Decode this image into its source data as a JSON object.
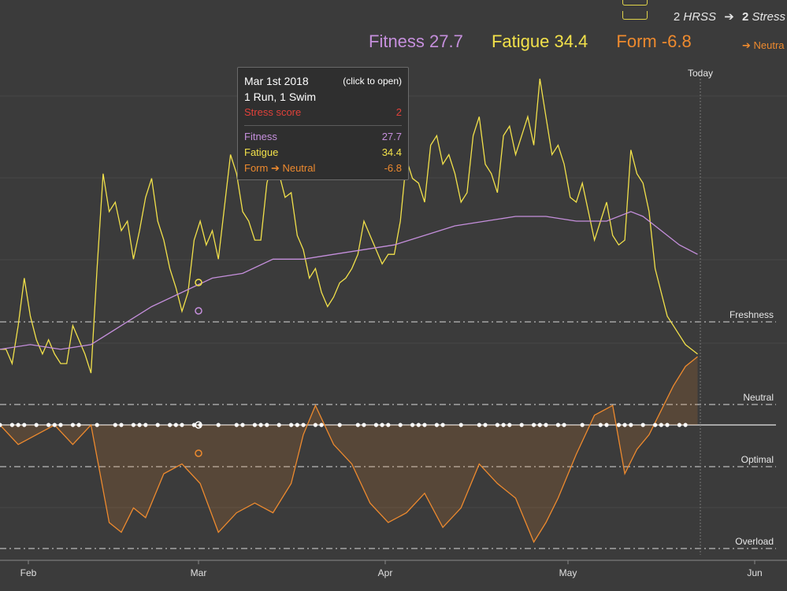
{
  "header": {
    "hrss_value": "2",
    "hrss_label": "HRSS",
    "arrow": "➔",
    "stress_value": "2",
    "stress_label": "Stress"
  },
  "legend": {
    "fitness": "Fitness 27.7",
    "fatigue": "Fatigue 34.4",
    "form": "Form -6.8",
    "form_status": "➔ Neutra"
  },
  "tooltip": {
    "date": "Mar 1st 2018",
    "open_link": "(click to open)",
    "activities": "1 Run, 1 Swim",
    "stress_label": "Stress score",
    "stress_value": "2",
    "fitness_label": "Fitness",
    "fitness_value": "27.7",
    "fatigue_label": "Fatigue",
    "fatigue_value": "34.4",
    "form_label": "Form ➔ Neutral",
    "form_value": "-6.8"
  },
  "colors": {
    "fitness": "#c58fdc",
    "fatigue": "#f2e14a",
    "form": "#ee8a2e",
    "stress": "#e0413a",
    "background": "#3b3b3b"
  },
  "chart_data": {
    "type": "line",
    "x_ticks": [
      "Feb",
      "Mar",
      "Apr",
      "May",
      "Jun"
    ],
    "today_label": "Today",
    "zone_labels": [
      "Freshness",
      "Neutral",
      "Optimal",
      "Overload"
    ],
    "series": [
      {
        "name": "Fatigue",
        "points": [
          [
            0,
            43
          ],
          [
            1,
            43
          ],
          [
            2,
            40
          ],
          [
            3,
            48
          ],
          [
            4,
            58
          ],
          [
            5,
            50
          ],
          [
            6,
            45
          ],
          [
            7,
            42
          ],
          [
            8,
            45
          ],
          [
            9,
            42
          ],
          [
            10,
            40
          ],
          [
            11,
            40
          ],
          [
            12,
            48
          ],
          [
            13,
            45
          ],
          [
            14,
            42
          ],
          [
            15,
            38
          ],
          [
            16,
            60
          ],
          [
            17,
            80
          ],
          [
            18,
            72
          ],
          [
            19,
            74
          ],
          [
            20,
            68
          ],
          [
            21,
            70
          ],
          [
            22,
            62
          ],
          [
            23,
            68
          ],
          [
            24,
            75
          ],
          [
            25,
            79
          ],
          [
            26,
            70
          ],
          [
            27,
            66
          ],
          [
            28,
            60
          ],
          [
            29,
            56
          ],
          [
            30,
            51
          ],
          [
            31,
            55
          ],
          [
            32,
            66
          ],
          [
            33,
            70
          ],
          [
            34,
            65
          ],
          [
            35,
            68
          ],
          [
            36,
            62
          ],
          [
            37,
            73
          ],
          [
            38,
            84
          ],
          [
            39,
            80
          ],
          [
            40,
            72
          ],
          [
            41,
            70
          ],
          [
            42,
            66
          ],
          [
            43,
            66
          ],
          [
            44,
            78
          ],
          [
            45,
            83
          ],
          [
            46,
            80
          ],
          [
            47,
            75
          ],
          [
            48,
            76
          ],
          [
            49,
            67
          ],
          [
            50,
            64
          ],
          [
            51,
            58
          ],
          [
            52,
            60
          ],
          [
            53,
            55
          ],
          [
            54,
            52
          ],
          [
            55,
            54
          ],
          [
            56,
            57
          ],
          [
            57,
            58
          ],
          [
            58,
            60
          ],
          [
            59,
            63
          ],
          [
            60,
            70
          ],
          [
            61,
            67
          ],
          [
            62,
            64
          ],
          [
            63,
            61
          ],
          [
            64,
            63
          ],
          [
            65,
            63
          ],
          [
            66,
            70
          ],
          [
            67,
            83
          ],
          [
            68,
            79
          ],
          [
            69,
            78
          ],
          [
            70,
            74
          ],
          [
            71,
            86
          ],
          [
            72,
            88
          ],
          [
            73,
            82
          ],
          [
            74,
            84
          ],
          [
            75,
            80
          ],
          [
            76,
            74
          ],
          [
            77,
            76
          ],
          [
            78,
            88
          ],
          [
            79,
            92
          ],
          [
            80,
            82
          ],
          [
            81,
            80
          ],
          [
            82,
            76
          ],
          [
            83,
            88
          ],
          [
            84,
            90
          ],
          [
            85,
            84
          ],
          [
            86,
            88
          ],
          [
            87,
            92
          ],
          [
            88,
            86
          ],
          [
            89,
            100
          ],
          [
            90,
            92
          ],
          [
            91,
            84
          ],
          [
            92,
            86
          ],
          [
            93,
            82
          ],
          [
            94,
            75
          ],
          [
            95,
            74
          ],
          [
            96,
            78
          ],
          [
            97,
            72
          ],
          [
            98,
            66
          ],
          [
            99,
            70
          ],
          [
            100,
            74
          ],
          [
            101,
            67
          ],
          [
            102,
            65
          ],
          [
            103,
            66
          ],
          [
            104,
            85
          ],
          [
            105,
            80
          ],
          [
            106,
            78
          ],
          [
            107,
            72
          ],
          [
            108,
            60
          ],
          [
            109,
            55
          ],
          [
            110,
            50
          ],
          [
            111,
            48
          ],
          [
            112,
            46
          ],
          [
            113,
            44
          ],
          [
            114,
            43
          ],
          [
            115,
            42
          ]
        ]
      },
      {
        "name": "Fitness",
        "points": [
          [
            0,
            43
          ],
          [
            5,
            44
          ],
          [
            10,
            43
          ],
          [
            15,
            44
          ],
          [
            20,
            48
          ],
          [
            25,
            52
          ],
          [
            30,
            55
          ],
          [
            35,
            58
          ],
          [
            40,
            59
          ],
          [
            45,
            62
          ],
          [
            50,
            62
          ],
          [
            55,
            63
          ],
          [
            60,
            64
          ],
          [
            65,
            65
          ],
          [
            70,
            67
          ],
          [
            75,
            69
          ],
          [
            80,
            70
          ],
          [
            85,
            71
          ],
          [
            90,
            71
          ],
          [
            95,
            70
          ],
          [
            100,
            70
          ],
          [
            104,
            72
          ],
          [
            106,
            71
          ],
          [
            108,
            69
          ],
          [
            110,
            67
          ],
          [
            112,
            65
          ],
          [
            115,
            63
          ]
        ]
      },
      {
        "name": "Form",
        "points": [
          [
            0,
            0
          ],
          [
            3,
            -4
          ],
          [
            6,
            -2
          ],
          [
            9,
            0
          ],
          [
            12,
            -4
          ],
          [
            15,
            0
          ],
          [
            18,
            -20
          ],
          [
            20,
            -22
          ],
          [
            22,
            -17
          ],
          [
            24,
            -19
          ],
          [
            27,
            -10
          ],
          [
            30,
            -8
          ],
          [
            33,
            -12
          ],
          [
            36,
            -22
          ],
          [
            39,
            -18
          ],
          [
            42,
            -16
          ],
          [
            45,
            -18
          ],
          [
            48,
            -12
          ],
          [
            50,
            -2
          ],
          [
            52,
            4
          ],
          [
            55,
            -4
          ],
          [
            58,
            -8
          ],
          [
            61,
            -16
          ],
          [
            64,
            -20
          ],
          [
            67,
            -18
          ],
          [
            70,
            -14
          ],
          [
            73,
            -21
          ],
          [
            76,
            -17
          ],
          [
            79,
            -8
          ],
          [
            82,
            -12
          ],
          [
            85,
            -15
          ],
          [
            88,
            -24
          ],
          [
            90,
            -20
          ],
          [
            92,
            -15
          ],
          [
            95,
            -6
          ],
          [
            98,
            2
          ],
          [
            101,
            4
          ],
          [
            103,
            -10
          ],
          [
            105,
            -5
          ],
          [
            107,
            -2
          ],
          [
            109,
            3
          ],
          [
            111,
            8
          ],
          [
            113,
            12
          ],
          [
            115,
            14
          ]
        ]
      }
    ]
  }
}
